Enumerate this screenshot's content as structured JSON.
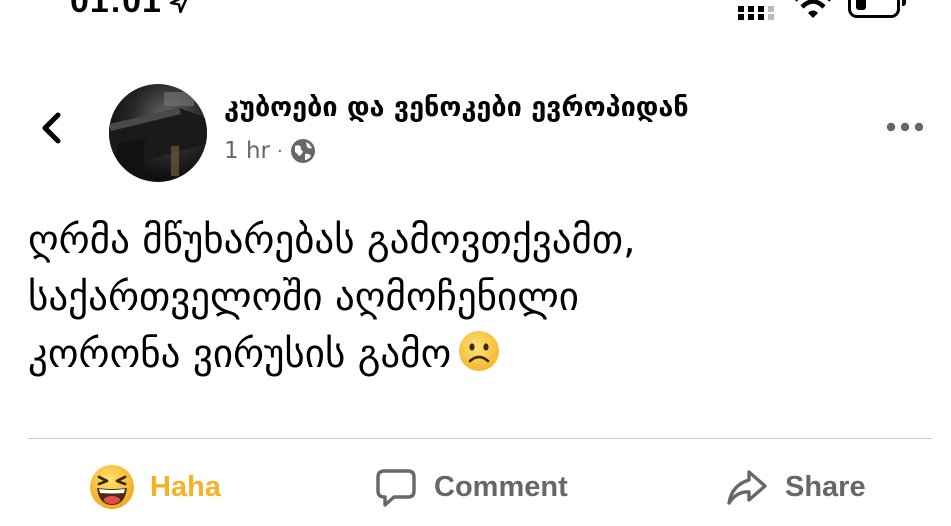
{
  "status_bar": {
    "time": "01:01"
  },
  "post": {
    "page_name": "კუბოები და ვენოკები ევროპიდან",
    "time": "1 hr",
    "separator": "·",
    "text_lines": [
      "ღრმა მწუხარებას გამოვთქვამთ,",
      "საქართველოში აღმოჩენილი",
      "კორონა ვირუსის გამო"
    ]
  },
  "actions": {
    "reaction_label": "Haha",
    "comment_label": "Comment",
    "share_label": "Share"
  },
  "colors": {
    "haha": "#f7b125",
    "muted": "#65676b"
  }
}
